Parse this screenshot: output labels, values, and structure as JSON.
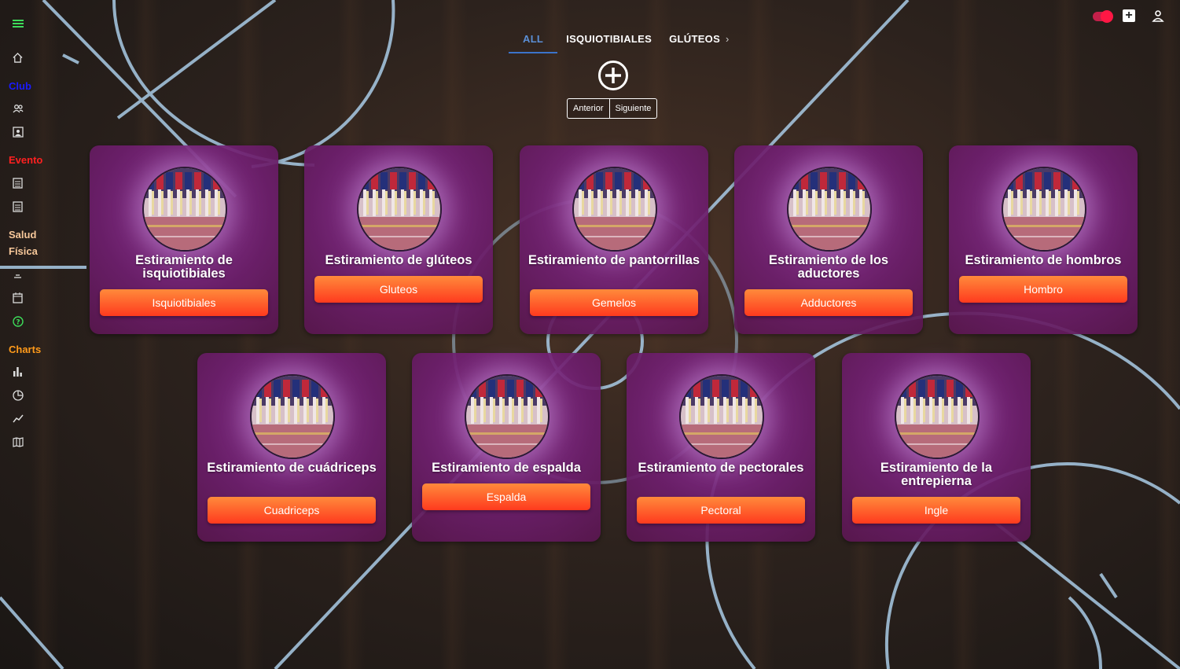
{
  "sidebar": {
    "menu_icon": "hamburger-menu-icon",
    "sections": [
      {
        "label": "Club",
        "color": "#1a1aff"
      },
      {
        "label": "Evento",
        "color": "#ff2020"
      },
      {
        "label": "Salud",
        "color": "#f7c89a"
      },
      {
        "label": "Física",
        "color": "#f7c89a"
      },
      {
        "label": "Charts",
        "color": "#ff9a1a"
      }
    ]
  },
  "topbar": {
    "toggle_state": "on",
    "accent_color": "#ff1744"
  },
  "tabs": {
    "items": [
      "ALL",
      "ISQUIOTIBIALES",
      "GLÚTEOS"
    ],
    "active": "ALL",
    "more_arrow": "›"
  },
  "pager": {
    "prev_label": "Anterior",
    "next_label": "Siguiente"
  },
  "cards": [
    {
      "title": "Estiramiento de isquiotibiales",
      "button": "Isquiotibiales"
    },
    {
      "title": "Estiramiento de glúteos",
      "button": "Gluteos"
    },
    {
      "title": "Estiramiento de pantorrillas",
      "button": "Gemelos"
    },
    {
      "title": "Estiramiento de los aductores",
      "button": "Adductores"
    },
    {
      "title": "Estiramiento de hombros",
      "button": "Hombro"
    },
    {
      "title": "Estiramiento de cuádriceps",
      "button": "Cuadriceps"
    },
    {
      "title": "Estiramiento de espalda",
      "button": "Espalda"
    },
    {
      "title": "Estiramiento de pectorales",
      "button": "Pectoral"
    },
    {
      "title": "Estiramiento de la entrepierna",
      "button": "Ingle"
    }
  ],
  "colors": {
    "button_top": "#ff8a3b",
    "button_bottom": "#ff3a1e",
    "tab_active": "#5b8fd6",
    "card_bg": "#7a2a80"
  }
}
